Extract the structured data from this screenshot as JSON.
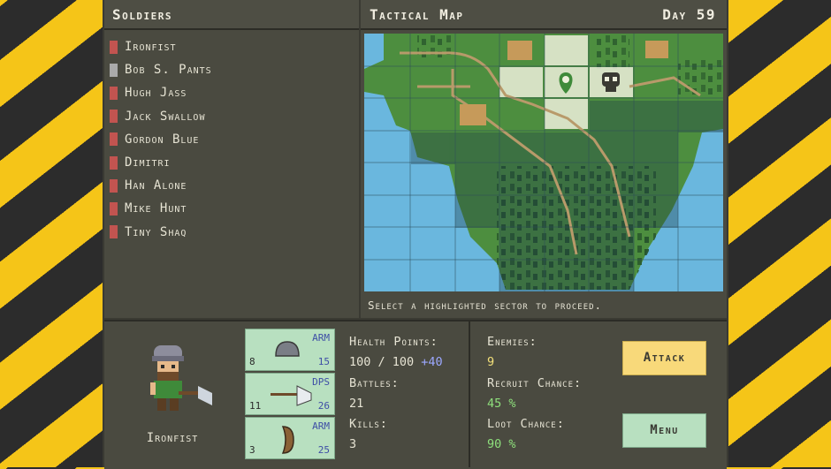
{
  "soldiers_panel": {
    "title": "Soldiers"
  },
  "map_panel": {
    "title": "Tactical Map",
    "day": "Day 59",
    "status": "Select a highlighted sector to proceed."
  },
  "soldiers": [
    {
      "name": "Ironfist",
      "selected": true
    },
    {
      "name": "Bob S. Pants",
      "selected": false
    },
    {
      "name": "Hugh Jass",
      "selected": false
    },
    {
      "name": "Jack Swallow",
      "selected": false
    },
    {
      "name": "Gordon Blue",
      "selected": false
    },
    {
      "name": "Dimitri",
      "selected": false
    },
    {
      "name": "Han Alone",
      "selected": false
    },
    {
      "name": "Mike Hunt",
      "selected": false
    },
    {
      "name": "Tiny Shaq",
      "selected": false
    }
  ],
  "selected_soldier": {
    "name": "Ironfist"
  },
  "equipment": [
    {
      "slot": "helmet",
      "tag": "ARM",
      "low": "8",
      "high": "15"
    },
    {
      "slot": "axe",
      "tag": "DPS",
      "low": "11",
      "high": "26"
    },
    {
      "slot": "shield",
      "tag": "ARM",
      "low": "3",
      "high": "25"
    }
  ],
  "stats": {
    "health_label": "Health Points:",
    "health_value": "100 / 100",
    "health_bonus": "+40",
    "battles_label": "Battles:",
    "battles_value": "21",
    "kills_label": "Kills:",
    "kills_value": "3"
  },
  "sector": {
    "enemies_label": "Enemies:",
    "enemies_value": "9",
    "recruit_label": "Recruit Chance:",
    "recruit_value": "45 %",
    "loot_label": "Loot Chance:",
    "loot_value": "90 %"
  },
  "buttons": {
    "attack": "Attack",
    "menu": "Menu"
  },
  "colors": {
    "accent_yellow": "#f8d97a",
    "accent_green": "#b8e0c0",
    "water": "#6ab7de",
    "land": "#3f7d3a",
    "highlight": "#e8ecd6"
  }
}
